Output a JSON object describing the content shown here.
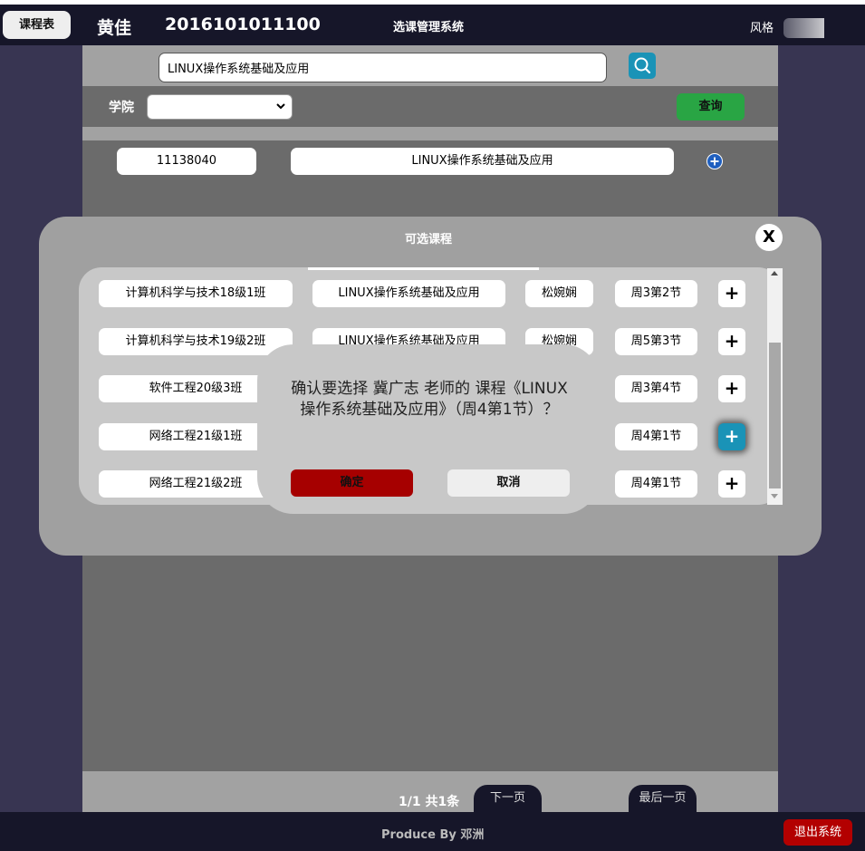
{
  "header": {
    "schedule_button": "课程表",
    "user_name": "黄佳",
    "user_id": "2016101011100",
    "system_title": "选课管理系统",
    "style_label": "风格"
  },
  "search": {
    "value": "LINUX操作系统基础及应用",
    "icon": "search-icon"
  },
  "filter": {
    "college_label": "学院",
    "college_selected": "",
    "query_button": "查询"
  },
  "result": {
    "course_id": "11138040",
    "course_name": "LINUX操作系统基础及应用"
  },
  "modal": {
    "title": "可选课程",
    "close": "X",
    "rows": [
      {
        "class": "计算机科学与技术18级1班",
        "course": "LINUX操作系统基础及应用",
        "teacher": "松婉娴",
        "time": "周3第2节",
        "add": "+"
      },
      {
        "class": "计算机科学与技术19级2班",
        "course": "LINUX操作系统基础及应用",
        "teacher": "松婉娴",
        "time": "周5第3节",
        "add": "+"
      },
      {
        "class": "软件工程20级3班",
        "course": "",
        "teacher": "",
        "time": "周3第4节",
        "add": "+"
      },
      {
        "class": "网络工程21级1班",
        "course": "",
        "teacher": "",
        "time": "周4第1节",
        "add": "+"
      },
      {
        "class": "网络工程21级2班",
        "course": "",
        "teacher": "",
        "time": "周4第1节",
        "add": "+"
      }
    ]
  },
  "confirm": {
    "message": "确认要选择 冀广志 老师的 课程《LINUX操作系统基础及应用》（周4第1节）？",
    "ok": "确定",
    "cancel": "取消"
  },
  "pager": {
    "info": "1/1 共1条",
    "next": "下一页",
    "last": "最后一页"
  },
  "footer": {
    "credit": "Produce By 邓洲",
    "logout": "退出系统"
  },
  "colors": {
    "topbar": "#161629",
    "sidebar": "#383552",
    "accent": "#1a93b7",
    "query": "#29a544",
    "danger": "#a60000"
  }
}
